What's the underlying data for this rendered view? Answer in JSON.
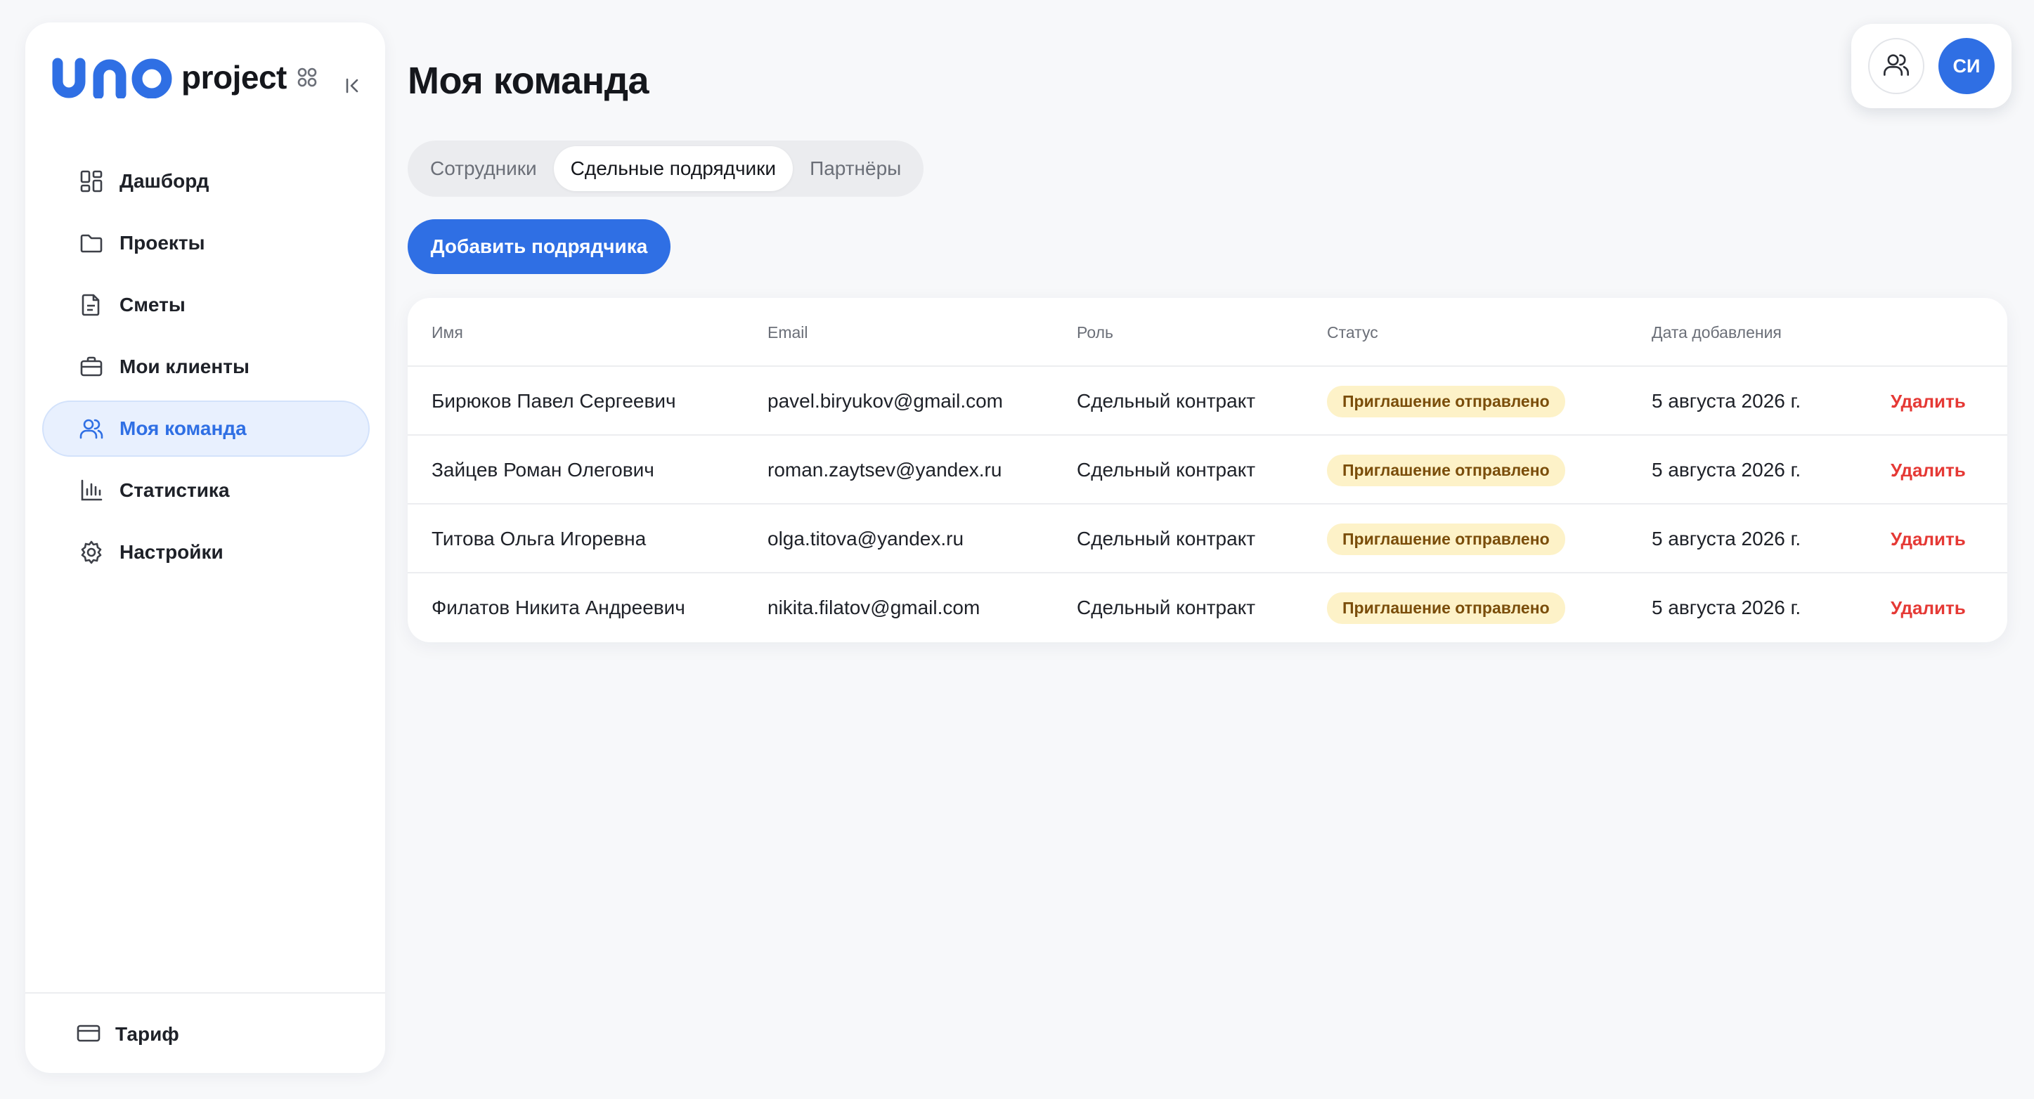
{
  "brand": {
    "logo_text": "uno",
    "name": "project"
  },
  "sidebar": {
    "items": [
      {
        "label": "Дашборд",
        "icon": "dashboard-icon",
        "active": false
      },
      {
        "label": "Проекты",
        "icon": "folder-icon",
        "active": false
      },
      {
        "label": "Сметы",
        "icon": "document-icon",
        "active": false
      },
      {
        "label": "Мои клиенты",
        "icon": "briefcase-icon",
        "active": false
      },
      {
        "label": "Моя команда",
        "icon": "users-icon",
        "active": true
      },
      {
        "label": "Статистика",
        "icon": "bar-chart-icon",
        "active": false
      },
      {
        "label": "Настройки",
        "icon": "gear-icon",
        "active": false
      }
    ],
    "footer": {
      "label": "Тариф",
      "icon": "credit-card-icon"
    }
  },
  "page": {
    "title": "Моя команда"
  },
  "tabs": [
    {
      "label": "Сотрудники",
      "active": false
    },
    {
      "label": "Сдельные подрядчики",
      "active": true
    },
    {
      "label": "Партнёры",
      "active": false
    }
  ],
  "add_button": {
    "label": "Добавить подрядчика"
  },
  "table": {
    "headers": {
      "name": "Имя",
      "email": "Email",
      "role": "Роль",
      "status": "Статус",
      "date": "Дата добавления"
    },
    "rows": [
      {
        "name": "Бирюков Павел Сергеевич",
        "email": "pavel.biryukov@gmail.com",
        "role": "Сдельный контракт",
        "status": "Приглашение отправлено",
        "date": "5 августа 2026 г.",
        "action": "Удалить"
      },
      {
        "name": "Зайцев Роман Олегович",
        "email": "roman.zaytsev@yandex.ru",
        "role": "Сдельный контракт",
        "status": "Приглашение отправлено",
        "date": "5 августа 2026 г.",
        "action": "Удалить"
      },
      {
        "name": "Титова Ольга Игоревна",
        "email": "olga.titova@yandex.ru",
        "role": "Сдельный контракт",
        "status": "Приглашение отправлено",
        "date": "5 августа 2026 г.",
        "action": "Удалить"
      },
      {
        "name": "Филатов Никита Андреевич",
        "email": "nikita.filatov@gmail.com",
        "role": "Сдельный контракт",
        "status": "Приглашение отправлено",
        "date": "5 августа 2026 г.",
        "action": "Удалить"
      }
    ]
  },
  "user": {
    "initials": "СИ"
  },
  "colors": {
    "accent": "#2f6fe4",
    "badge_bg": "#fdf2c8",
    "badge_text": "#7a4d0a",
    "danger": "#e53935"
  }
}
